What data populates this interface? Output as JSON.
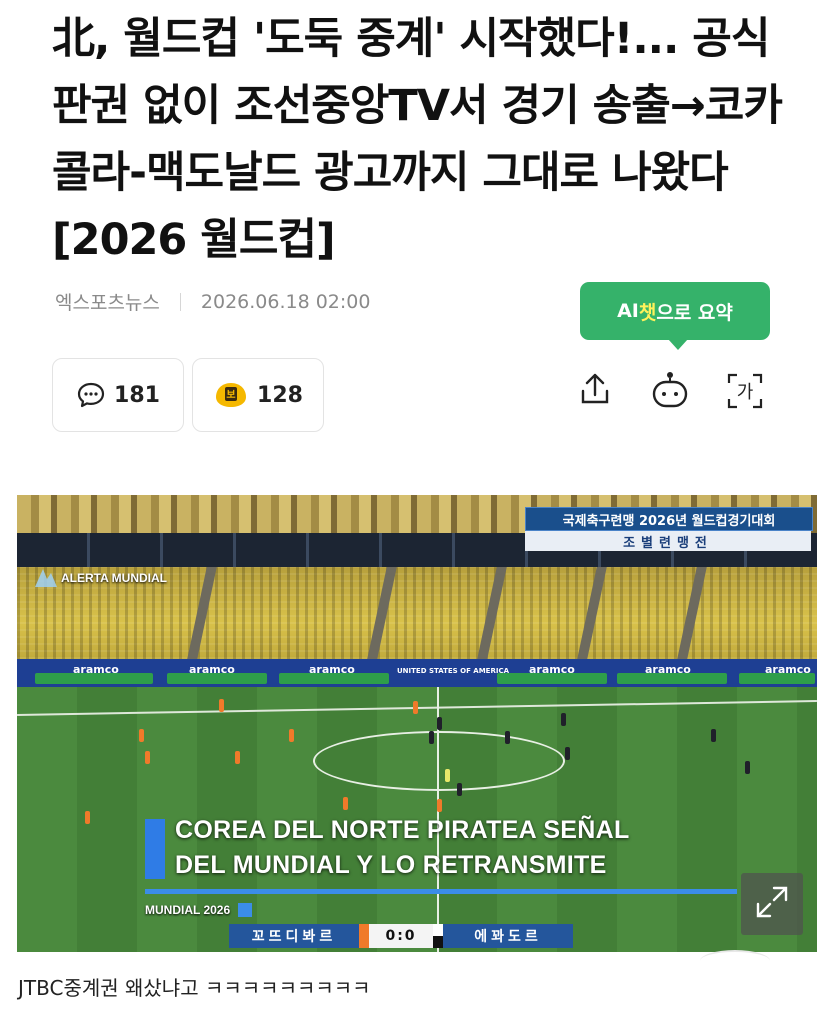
{
  "article": {
    "headline": "北, 월드컵 '도둑 중계' 시작했다!... 공식 판권 없이 조선중앙TV서 경기 송출→코카콜라-맥도날드 광고까지 그대로 나왔다 [2026 월드컵]",
    "source": "엑스포츠뉴스",
    "timestamp": "2026.06.18 02:00"
  },
  "ai_summary": {
    "label_prefix": "AI",
    "label_accent": "챗",
    "label_suffix": "으로 요약"
  },
  "reactions": {
    "comments_count": "181",
    "like_count": "128"
  },
  "toolbar": {
    "share_icon": "share-icon",
    "bot_icon": "bot-icon",
    "font_icon_label": "가"
  },
  "broadcast": {
    "kp_title": "국제축구련맹 2026년 월드컵경기대회",
    "kp_subtitle": "조별련맹전",
    "alerta": "ALERTA MUNDIAL",
    "board_ads": [
      "aramco",
      "aramco",
      "aramco",
      "UNITED STATES OF AMERICA",
      "aramco",
      "aramco",
      "aramco"
    ],
    "headline_line1": "COREA DEL NORTE PIRATEA SEÑAL",
    "headline_line2": "DEL MUNDIAL Y LO RETRANSMITE",
    "mundial_tag": "MUNDIAL 2026",
    "team_left": "꼬뜨디봐르",
    "score": "0:0",
    "team_right": "에꽈도르"
  },
  "caption": "JTBC중계권 왜샀냐고 ㅋㅋㅋㅋㅋㅋㅋㅋㅋ",
  "colors": {
    "accent_green": "#35b26a",
    "caption_blue": "#3b8de8"
  }
}
